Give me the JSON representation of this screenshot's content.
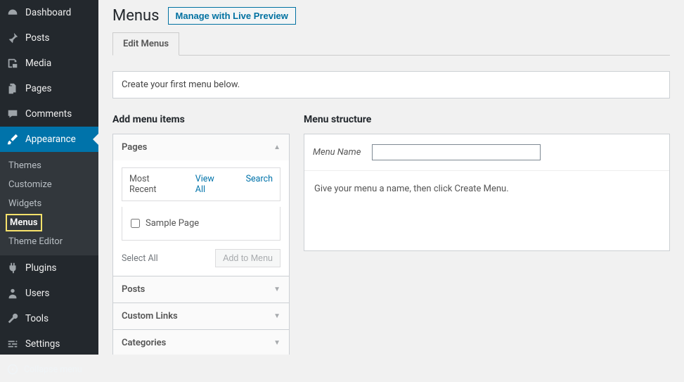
{
  "sidebar": {
    "items": [
      {
        "key": "dashboard",
        "label": "Dashboard"
      },
      {
        "key": "posts",
        "label": "Posts"
      },
      {
        "key": "media",
        "label": "Media"
      },
      {
        "key": "pages",
        "label": "Pages"
      },
      {
        "key": "comments",
        "label": "Comments"
      },
      {
        "key": "appearance",
        "label": "Appearance"
      },
      {
        "key": "plugins",
        "label": "Plugins"
      },
      {
        "key": "users",
        "label": "Users"
      },
      {
        "key": "tools",
        "label": "Tools"
      },
      {
        "key": "settings",
        "label": "Settings"
      }
    ],
    "appearance_children": [
      "Themes",
      "Customize",
      "Widgets",
      "Menus",
      "Theme Editor"
    ],
    "current_sub": "Menus",
    "collapse": "Collapse menu"
  },
  "page": {
    "title": "Menus",
    "preview_button": "Manage with Live Preview",
    "tabs": [
      "Edit Menus"
    ],
    "active_tab": "Edit Menus",
    "notice": "Create your first menu below."
  },
  "add_items": {
    "heading": "Add menu items",
    "accordions": [
      "Pages",
      "Posts",
      "Custom Links",
      "Categories"
    ],
    "open": "Pages",
    "pages": {
      "tabs": [
        "Most Recent",
        "View All",
        "Search"
      ],
      "active_tab": "Most Recent",
      "items": [
        "Sample Page"
      ],
      "select_all": "Select All",
      "add_button": "Add to Menu"
    }
  },
  "structure": {
    "heading": "Menu structure",
    "name_label": "Menu Name",
    "name_value": "",
    "hint": "Give your menu a name, then click Create Menu."
  },
  "icons": {
    "dashboard": "dashboard-icon",
    "posts": "pin-icon",
    "media": "media-icon",
    "pages": "pages-icon",
    "comments": "comment-icon",
    "appearance": "brush-icon",
    "plugins": "plug-icon",
    "users": "user-icon",
    "tools": "wrench-icon",
    "settings": "sliders-icon",
    "collapse": "collapse-icon"
  }
}
